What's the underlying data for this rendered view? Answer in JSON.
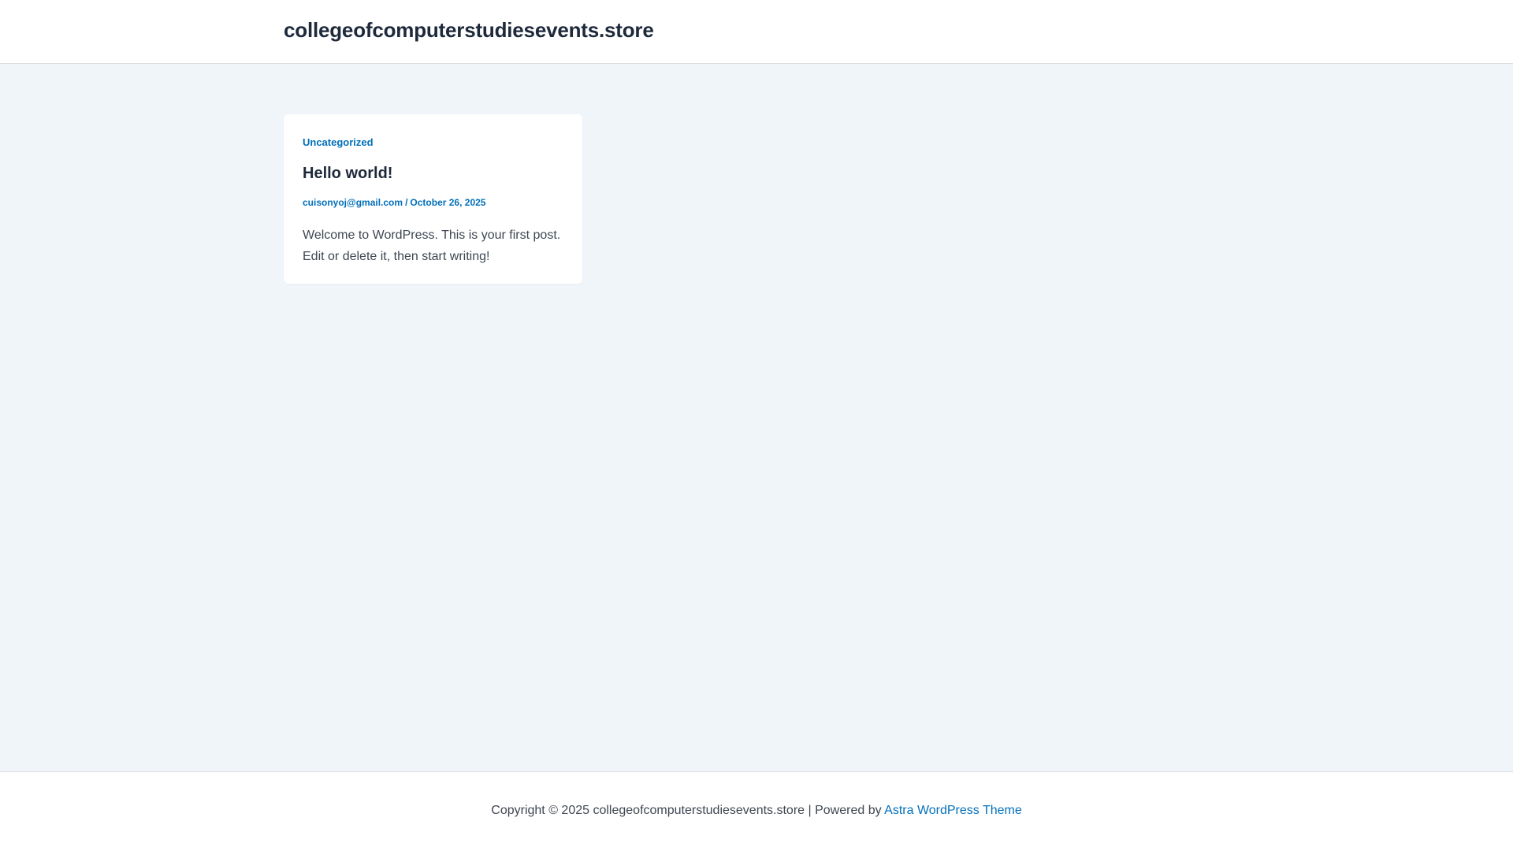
{
  "header": {
    "site_title": "collegeofcomputerstudiesevents.store"
  },
  "post": {
    "category": "Uncategorized",
    "title": "Hello world!",
    "author": "cuisonyoj@gmail.com",
    "separator": "/",
    "date": "October 26, 2025",
    "excerpt": "Welcome to WordPress. This is your first post. Edit or delete it, then start writing!"
  },
  "footer": {
    "copyright_prefix": "Copyright © 2025 collegeofcomputerstudiesevents.store | Powered by ",
    "theme_link": "Astra WordPress Theme"
  },
  "colors": {
    "accent": "#0170b9",
    "heading": "#1e293b",
    "body_text": "#3f4752",
    "page_background": "#f0f5fa"
  }
}
